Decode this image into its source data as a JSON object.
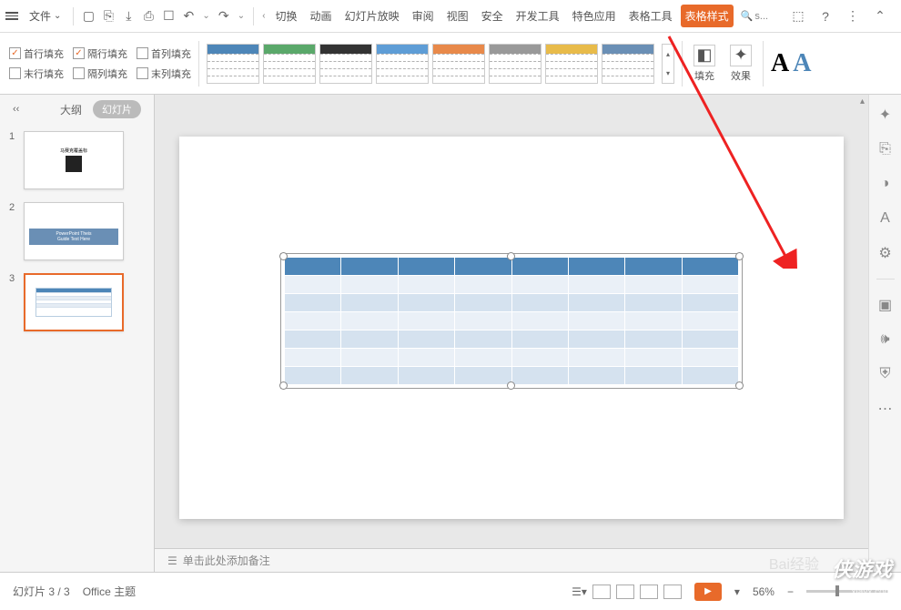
{
  "menubar": {
    "file": "文件",
    "tabs": [
      "切换",
      "动画",
      "幻灯片放映",
      "审阅",
      "视图",
      "安全",
      "开发工具",
      "特色应用",
      "表格工具",
      "表格样式"
    ],
    "active_tab": "表格样式",
    "search": "s..."
  },
  "ribbon": {
    "checks": {
      "r1c1": "首行填充",
      "r1c2": "隔行填充",
      "r1c3": "首列填充",
      "r2c1": "末行填充",
      "r2c2": "隔列填充",
      "r2c3": "末列填充"
    },
    "fill_label": "填充",
    "effect_label": "效果",
    "style_colors": [
      "#4d86b8",
      "#5aa86a",
      "#333333",
      "#5e9dd6",
      "#e8894a",
      "#999999",
      "#e8bb4a",
      "#6a8fb5"
    ]
  },
  "panel": {
    "outline": "大纲",
    "slides": "幻灯片",
    "collapse": "‹‹",
    "thumb2_title": "PowerPoint Theis",
    "thumb2_sub": "Guide Text Here"
  },
  "notes": "单击此处添加备注",
  "status": {
    "slide": "幻灯片 3 / 3",
    "theme": "Office 主题",
    "zoom": "56%"
  },
  "watermark": {
    "main": "侠游戏",
    "url": "xiayx.com",
    "baidu": "Bai经验"
  }
}
